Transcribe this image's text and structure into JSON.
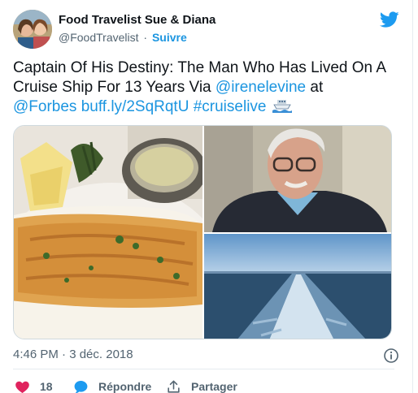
{
  "author": {
    "display_name": "Food Travelist Sue & Diana",
    "handle": "@FoodTravelist",
    "separator": "·",
    "follow_label": "Suivre"
  },
  "tweet": {
    "text_part1": "Captain Of His Destiny: The Man Who Has Lived On A Cruise Ship For 13 Years Via ",
    "mention_irene": "@irenelevine",
    "text_part2": " at ",
    "mention_forbes": "@Forbes",
    "link": "buff.ly/2SqRqtU",
    "hashtag": "#cruiselive",
    "emoji": "ship-emoji"
  },
  "meta": {
    "timestamp": "4:46 PM · 3 déc. 2018"
  },
  "actions": {
    "like_count": "18",
    "reply_label": "Répondre",
    "share_label": "Partager"
  },
  "colors": {
    "link": "#1b95e0",
    "like": "#e0245e",
    "text": "#0f1419",
    "muted": "#536471"
  }
}
